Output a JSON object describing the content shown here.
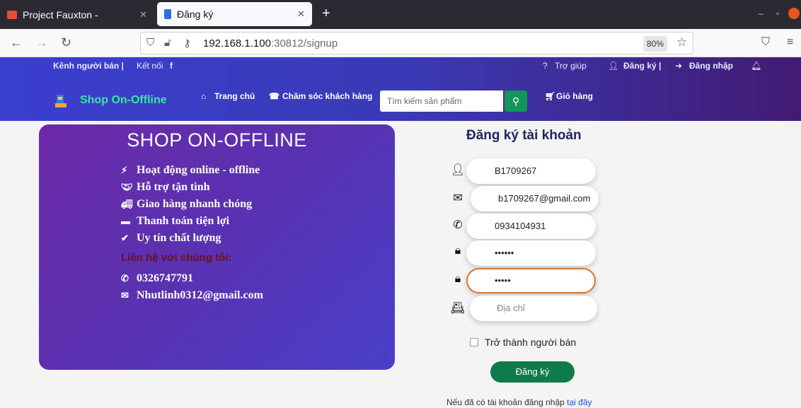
{
  "browser": {
    "tabs": [
      {
        "title": "Project Fauxton -",
        "favicon_color": "#e44a3d"
      },
      {
        "title": "Đăng ký",
        "favicon_color": "#2f6fd6"
      }
    ],
    "url_host": "192.168.1.100",
    "url_rest": ":30812/signup",
    "zoom": "80%"
  },
  "header": {
    "seller_channel": "Kênh người bán |",
    "connect": "Kết nối",
    "help": "Trợ giúp",
    "register": "Đăng ký |",
    "login": "Đăng nhập",
    "brand": "Shop On-Offline",
    "nav_home": "Trang chủ",
    "nav_support": "Chăm sóc khách hàng",
    "search_placeholder": "Tìm kiếm sản phẩm",
    "cart": "Giỏ hàng"
  },
  "card": {
    "title": "SHOP ON-OFFLINE",
    "features": [
      "Hoạt động online - offline",
      "Hỗ trợ tận tình",
      "Giao hàng nhanh chóng",
      "Thanh toán tiện lợi",
      "Uy tín chất lượng"
    ],
    "contact_heading": "Liên hệ với chúng tôi:",
    "phone": "0326747791",
    "email": "Nhutlinh0312@gmail.com"
  },
  "form": {
    "title": "Đăng ký tài khoản",
    "username": "B1709267",
    "email": "b1709267@gmail.com",
    "phone": "0934104931",
    "password": "••••••",
    "confirm_password": "•••••",
    "address_placeholder": "Địa chỉ",
    "become_seller": "Trở thành người bán",
    "submit": "Đăng ký",
    "footnote": "Nếu đã có tài khoản đăng nhập",
    "footnote_link": "tại đây"
  },
  "colors": {
    "accent_green": "#0f7a4b",
    "brand_green": "#39e6a1",
    "header_gradient_start": "#3b3fcf",
    "header_gradient_end": "#421b73"
  }
}
